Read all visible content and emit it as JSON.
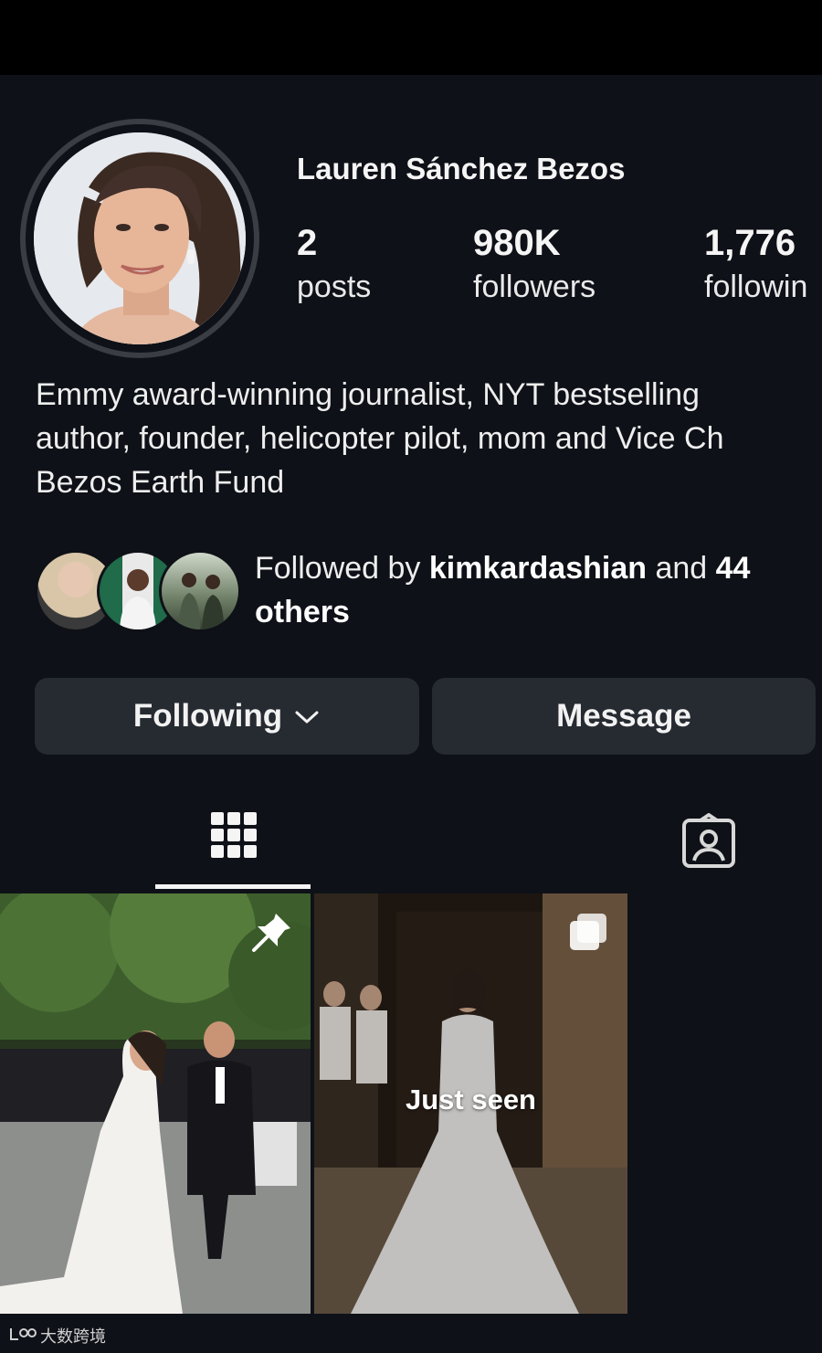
{
  "profile": {
    "name": "Lauren Sánchez Bezos",
    "stats": [
      {
        "value": "2",
        "label": "posts"
      },
      {
        "value": "980K",
        "label": "followers"
      },
      {
        "value": "1,776",
        "label": "followin"
      }
    ],
    "bio_lines": [
      "Emmy award-winning journalist, NYT bestselling",
      "author, founder, helicopter pilot, mom and Vice Ch",
      "Bezos Earth Fund"
    ]
  },
  "followed_by": {
    "prefix": "Followed by",
    "user": "kimkardashian",
    "middle": "and",
    "count": "44",
    "suffix": "others"
  },
  "buttons": {
    "following": "Following",
    "message": "Message"
  },
  "tabs": [
    {
      "icon": "grid-icon",
      "active": true
    },
    {
      "icon": "tagged-icon",
      "active": false
    }
  ],
  "posts": [
    {
      "pinned": true,
      "caption": ""
    },
    {
      "multi": true,
      "caption": "Just seen"
    }
  ],
  "watermark": "大数跨境",
  "colors": {
    "background": "#0e1117",
    "button": "#262a31",
    "text": "#f5f5f5"
  }
}
